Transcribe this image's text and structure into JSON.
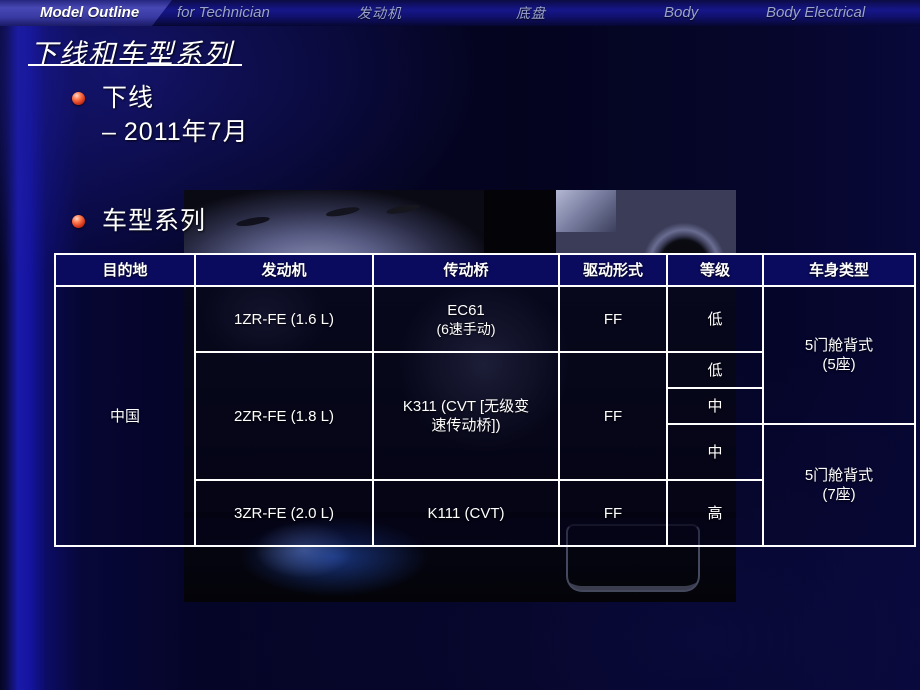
{
  "nav": {
    "items": [
      {
        "label": "Model Outline",
        "active": true,
        "cjk": false
      },
      {
        "label": "for Technician",
        "active": false,
        "cjk": false
      },
      {
        "label": "发动机",
        "active": false,
        "cjk": true
      },
      {
        "label": "底盘",
        "active": false,
        "cjk": true
      },
      {
        "label": "Body",
        "active": false,
        "cjk": false
      },
      {
        "label": "Body Electrical",
        "active": false,
        "cjk": false
      }
    ]
  },
  "title": "下线和车型系列",
  "bullets": [
    {
      "text": "下线",
      "sub_dash": "–",
      "sub": "2011年7月"
    },
    {
      "text": "车型系列"
    }
  ],
  "table": {
    "headers": [
      "目的地",
      "发动机",
      "传动桥",
      "驱动形式",
      "等级",
      "车身类型"
    ],
    "destination": "中国",
    "rows": [
      {
        "engine": "1ZR-FE (1.6 L)",
        "transmission_line1": "EC61",
        "transmission_line2": "(6速手动)",
        "drive": "FF",
        "grades": [
          "低"
        ],
        "body_line1": "5门舱背式",
        "body_line2": "(5座)"
      },
      {
        "engine": "2ZR-FE (1.8 L)",
        "transmission_line1": "K311 (CVT [无级变",
        "transmission_line2": "速传动桥])",
        "drive": "FF",
        "grades": [
          "低",
          "中",
          "中"
        ],
        "body_line1": "5门舱背式",
        "body_line2": "(7座)"
      },
      {
        "engine": "3ZR-FE (2.0 L)",
        "transmission_line1": "K111 (CVT)",
        "transmission_line2": "",
        "drive": "FF",
        "grades": [
          "高"
        ]
      }
    ]
  },
  "colors": {
    "background_deep": "#04041f",
    "background_blue": "#1a1aa8",
    "nav_bar": "#16168a",
    "table_fill": "#09094e",
    "text": "#ffffff",
    "nav_inactive_text": "#9aa3c8",
    "bullet_dot": "#d4341a"
  }
}
